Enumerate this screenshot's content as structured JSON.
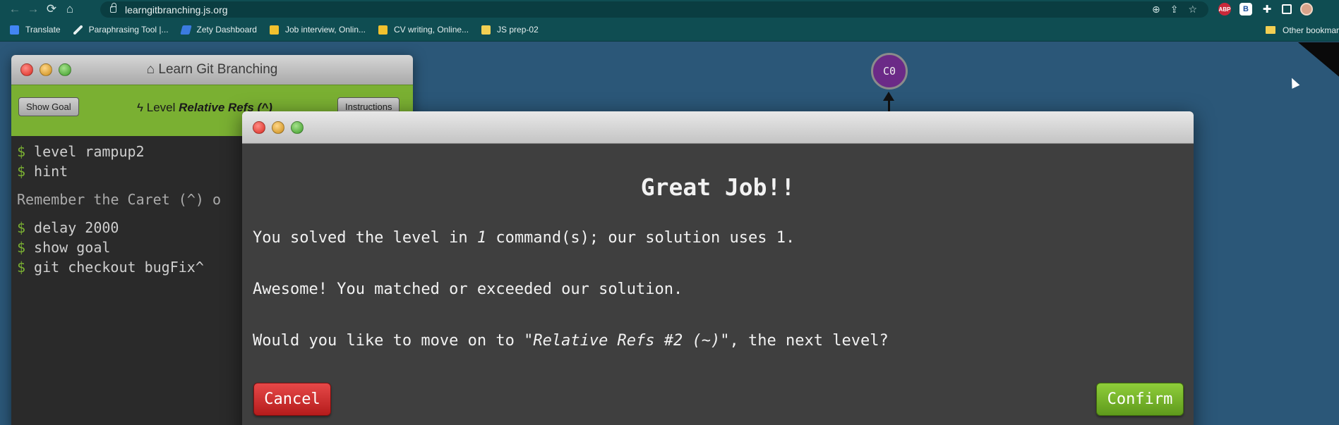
{
  "browser": {
    "url": "learngitbranching.js.org",
    "bookmarks": [
      {
        "label": "Translate",
        "color": "#4285f4"
      },
      {
        "label": "Paraphrasing Tool |...",
        "color": "#e6efef"
      },
      {
        "label": "Zety Dashboard",
        "color": "#3b7be0"
      },
      {
        "label": "Job interview, Onlin...",
        "color": "#f2c12e"
      },
      {
        "label": "CV writing, Online...",
        "color": "#f2c12e"
      },
      {
        "label": "JS prep-02",
        "color": "#f2cf53"
      }
    ],
    "other_bookmarks": "Other bookmarks",
    "extensions": [
      "zoom-icon",
      "share-icon",
      "star-icon",
      "adblock-icon",
      "b-extension-icon",
      "puzzle-icon",
      "sidebar-icon",
      "profile-avatar"
    ]
  },
  "lgb": {
    "title": "Learn Git Branching",
    "show_goal": "Show Goal",
    "level_prefix": "Level",
    "level_name": "Relative Refs (^)",
    "instructions": "Instructions",
    "terminal": [
      {
        "prompt": "$",
        "text": "level rampup2"
      },
      {
        "prompt": "$",
        "text": "hint"
      },
      {
        "prompt": "",
        "text": "Remember the Caret (^) o"
      },
      {
        "prompt": "$",
        "text": "delay 2000"
      },
      {
        "prompt": "$",
        "text": "show goal"
      },
      {
        "prompt": "$",
        "text": "git checkout bugFix^"
      }
    ]
  },
  "tree": {
    "commit_label": "C0"
  },
  "modal": {
    "heading": "Great Job!!",
    "p1_a": "You solved the level in ",
    "p1_num": "1",
    "p1_b": " command(s); our solution uses 1.",
    "p2": "Awesome! You matched or exceeded our solution.",
    "p3_a": "Would you like to move on to ",
    "p3_level": "\"Relative Refs #2 (~)\"",
    "p3_b": ", the next level?",
    "cancel": "Cancel",
    "confirm": "Confirm"
  }
}
